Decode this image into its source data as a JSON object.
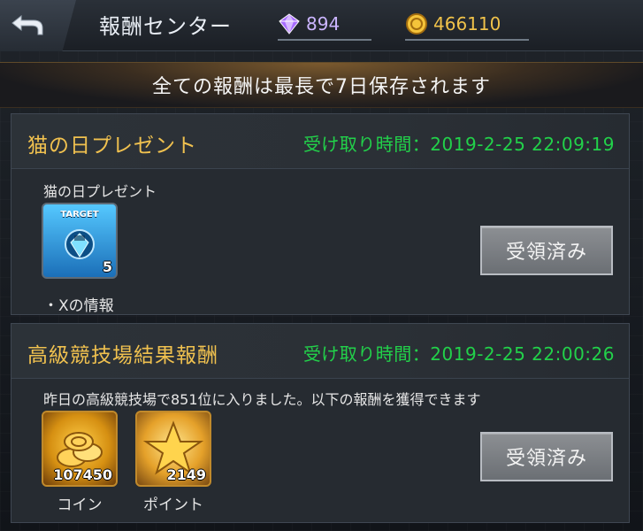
{
  "header": {
    "title": "報酬センター",
    "gems": "894",
    "coins": "466110",
    "back_icon": "back-arrow-icon",
    "gem_icon": "purple-gem-icon",
    "coin_icon": "gold-coin-icon"
  },
  "notice": {
    "text": "全ての報酬は最長で7日保存されます"
  },
  "rewards": [
    {
      "title": "猫の日プレゼント",
      "time_label": "受け取り時間：2019-2-25 22:09:19",
      "description": "猫の日プレゼント",
      "items": [
        {
          "name": "Xの情報",
          "count": "5",
          "icon": "target-card-icon",
          "art_label": "TARGET"
        }
      ],
      "caption": "・Xの情報",
      "status_button": "受領済み"
    },
    {
      "title": "高級競技場結果報酬",
      "time_label": "受け取り時間：2019-2-25 22:00:26",
      "description": "昨日の高級競技場で851位に入りました。以下の報酬を獲得できます",
      "items": [
        {
          "name": "コイン",
          "count": "107450",
          "icon": "coin-stack-icon"
        },
        {
          "name": "ポイント",
          "count": "2149",
          "icon": "star-icon"
        }
      ],
      "status_button": "受領済み"
    }
  ],
  "colors": {
    "title_gold": "#f0c14f",
    "time_green": "#22d14a",
    "card_bg": "#262b31"
  }
}
